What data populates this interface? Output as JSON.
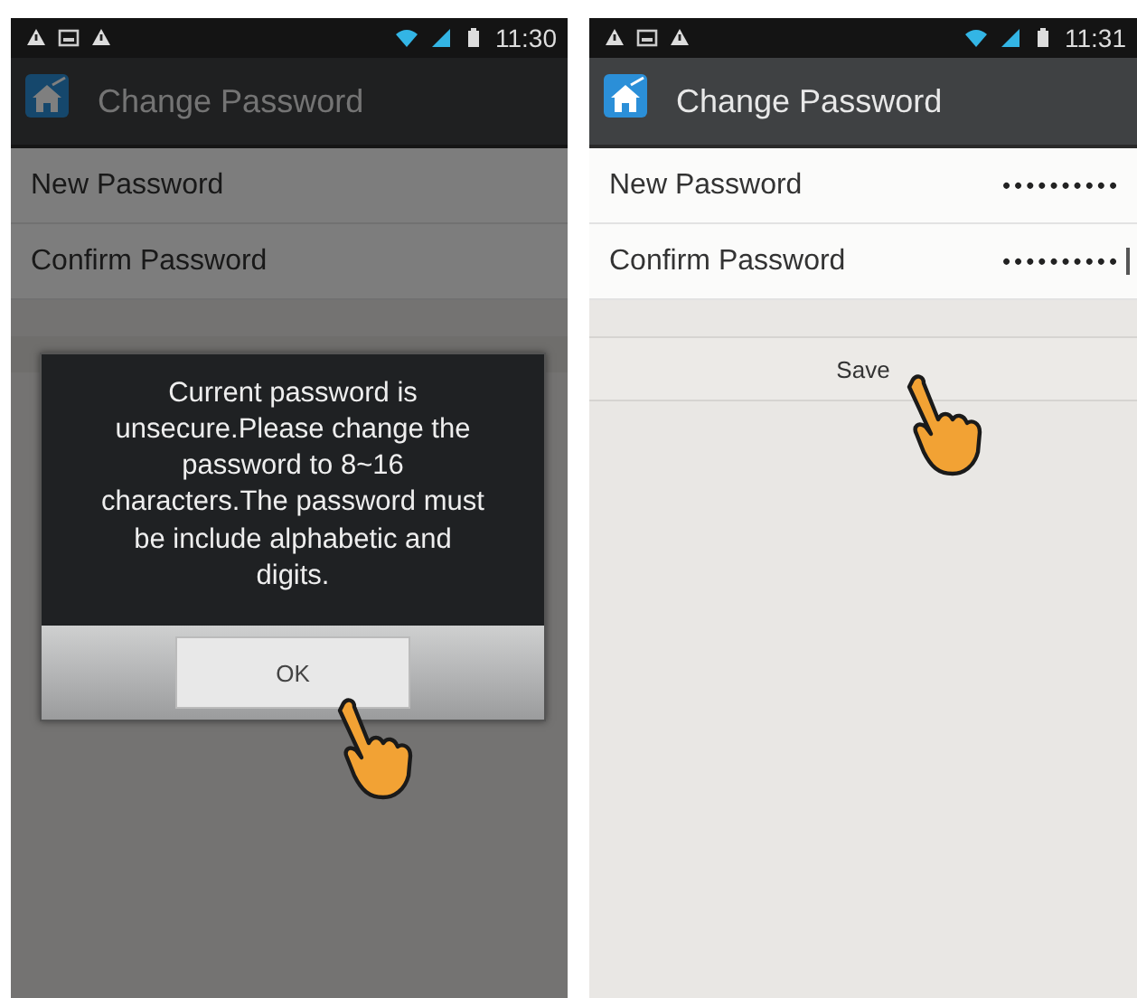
{
  "screens": [
    {
      "kind": "dialog",
      "status_bar": {
        "time": "11:30"
      },
      "title": "Change Password",
      "fields": [
        {
          "label": "New Password"
        },
        {
          "label": "Confirm Password"
        }
      ],
      "dialog": {
        "message": "Current password is unsecure.Please change the password to 8~16 characters.The password must be include alphabetic and digits.",
        "button": "OK"
      }
    },
    {
      "kind": "form",
      "status_bar": {
        "time": "11:31"
      },
      "title": "Change Password",
      "fields": [
        {
          "label": "New Password",
          "value": "••••••••••",
          "focused": false
        },
        {
          "label": "Confirm Password",
          "value": "••••••••••",
          "focused": true
        }
      ],
      "button": "Save"
    }
  ]
}
